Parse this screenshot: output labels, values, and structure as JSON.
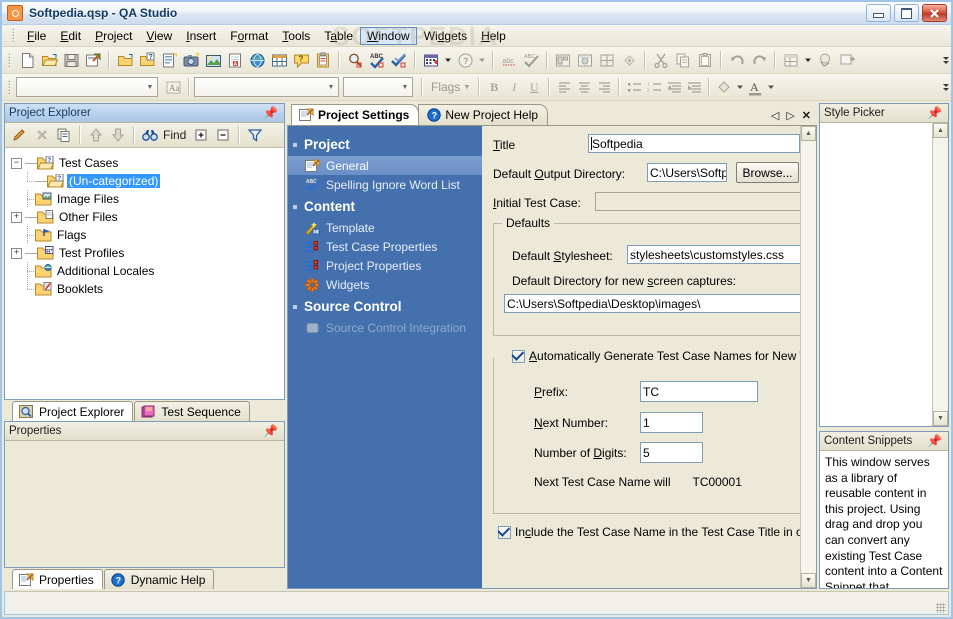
{
  "window": {
    "title": "Softpedia.qsp - QA Studio",
    "app_icon": "checkbox-orange-icon",
    "minimize": "–",
    "maximize": "□",
    "close": "✕"
  },
  "menubar": {
    "watermark": "SOFTPEDIA",
    "items": [
      {
        "label": "File",
        "accel": "F",
        "active": false
      },
      {
        "label": "Edit",
        "accel": "E",
        "active": false
      },
      {
        "label": "Project",
        "accel": "P",
        "active": false
      },
      {
        "label": "View",
        "accel": "V",
        "active": false
      },
      {
        "label": "Insert",
        "accel": "I",
        "active": false
      },
      {
        "label": "Format",
        "accel": "o",
        "active": false
      },
      {
        "label": "Tools",
        "accel": "T",
        "active": false
      },
      {
        "label": "Table",
        "accel": "a",
        "active": false
      },
      {
        "label": "Window",
        "accel": "W",
        "active": true
      },
      {
        "label": "Widgets",
        "accel": "d",
        "active": false
      },
      {
        "label": "Help",
        "accel": "H",
        "active": false
      }
    ]
  },
  "toolbar_main": {
    "buttons": [
      "new-document-icon",
      "open-folder-icon",
      "save-icon",
      "save-as-icon",
      "new-folder-icon",
      "new-test-case-icon",
      "new-page-icon",
      "screen-capture-icon",
      "insert-image-icon",
      "export-pdf-icon",
      "publish-web-icon",
      "insert-table-icon",
      "help-balloon-icon",
      "clipboard-icon",
      "find-icon",
      "spell-check-icon",
      "spell-check-all-icon",
      "calendar-add-icon",
      "help-circle-icon",
      "abc-icon",
      "spelling-icon",
      "widget-panel-icon",
      "widget-ball-icon",
      "grid-icon",
      "preview-icon",
      "cut-icon",
      "copy-icon",
      "paste-icon",
      "undo-icon",
      "redo-icon",
      "table-dropdown-icon",
      "globe-link-icon",
      "send-icon"
    ],
    "overflow": "more-buttons-icon"
  },
  "toolbar_format": {
    "style_combo_value": "",
    "font_combo_value": "",
    "size_combo_value": "",
    "change_case_icon": "change-case-icon",
    "flags_label": "Flags",
    "buttons": [
      "bold-icon",
      "italic-icon",
      "underline-icon",
      "align-left-icon",
      "align-center-icon",
      "align-right-icon",
      "bullet-list-icon",
      "numbered-list-icon",
      "decrease-indent-icon",
      "increase-indent-icon",
      "fill-color-icon",
      "font-color-icon"
    ],
    "overflow": "more-buttons-icon"
  },
  "project_explorer": {
    "title": "Project Explorer",
    "pin_icon": "pin-icon",
    "toolbar": {
      "edit": "edit-pencil-icon",
      "delete": "delete-x-icon",
      "copy": "copy-icon",
      "move_up": "arrow-up-icon",
      "move_down": "arrow-down-icon",
      "find_icon": "binoculars-icon",
      "find_label": "Find",
      "expand_all": "expand-all-icon",
      "collapse_all": "collapse-all-icon",
      "filter": "filter-funnel-icon"
    },
    "tree": [
      {
        "label": "Test Cases",
        "icon": "folder-test-cases-icon",
        "expander": "-",
        "depth": 0,
        "selected": false
      },
      {
        "label": "(Un-categorized)",
        "icon": "folder-test-cases-icon",
        "expander": "",
        "depth": 1,
        "selected": true
      },
      {
        "label": "Image Files",
        "icon": "folder-images-icon",
        "expander": "",
        "depth": 0,
        "selected": false
      },
      {
        "label": "Other Files",
        "icon": "folder-files-icon",
        "expander": "+",
        "depth": 0,
        "selected": false
      },
      {
        "label": "Flags",
        "icon": "folder-flags-icon",
        "expander": "",
        "depth": 0,
        "selected": false
      },
      {
        "label": "Test Profiles",
        "icon": "folder-profiles-icon",
        "expander": "+",
        "depth": 0,
        "selected": false
      },
      {
        "label": "Additional Locales",
        "icon": "folder-locales-icon",
        "expander": "",
        "depth": 0,
        "selected": false
      },
      {
        "label": "Booklets",
        "icon": "folder-booklets-icon",
        "expander": "",
        "depth": 0,
        "selected": false
      }
    ],
    "tabs": [
      {
        "label": "Project Explorer",
        "icon": "magnifier-icon",
        "selected": true
      },
      {
        "label": "Test Sequence",
        "icon": "book-icon",
        "selected": false
      }
    ]
  },
  "properties_panel": {
    "title": "Properties",
    "pin_icon": "pin-icon",
    "tabs": [
      {
        "label": "Properties",
        "icon": "properties-icon",
        "selected": true
      },
      {
        "label": "Dynamic Help",
        "icon": "help-circle-icon",
        "selected": false
      }
    ]
  },
  "document_tabs": {
    "tabs": [
      {
        "label": "Project Settings",
        "icon": "settings-icon",
        "selected": true
      },
      {
        "label": "New Project Help",
        "icon": "help-circle-icon",
        "selected": false
      }
    ],
    "nav_prev": "◁",
    "nav_next": "▷",
    "close": "✕"
  },
  "settings_nav": {
    "groups": [
      {
        "label": "Project",
        "items": [
          {
            "label": "General",
            "icon": "settings-icon",
            "selected": true,
            "disabled": false
          },
          {
            "label": "Spelling Ignore Word List",
            "icon": "spell-check-icon",
            "selected": false,
            "disabled": false
          }
        ]
      },
      {
        "label": "Content",
        "items": [
          {
            "label": "Template",
            "icon": "template-wand-icon",
            "selected": false,
            "disabled": false
          },
          {
            "label": "Test Case Properties",
            "icon": "list-properties-icon",
            "selected": false,
            "disabled": false
          },
          {
            "label": "Project Properties",
            "icon": "list-properties-icon",
            "selected": false,
            "disabled": false
          },
          {
            "label": "Widgets",
            "icon": "gear-icon",
            "selected": false,
            "disabled": false
          }
        ]
      },
      {
        "label": "Source Control",
        "items": [
          {
            "label": "Source Control Integration",
            "icon": "source-control-icon",
            "selected": false,
            "disabled": true
          }
        ]
      }
    ]
  },
  "settings_form": {
    "title_label": "Title",
    "title_accel": "T",
    "title_value": "Softpedia",
    "output_dir_label": "Default Output Directory:",
    "output_dir_accel": "O",
    "output_dir_value": "C:\\Users\\Softpı",
    "browse_label": "Browse...",
    "initial_test_case_label": "Initial Test Case:",
    "initial_test_case_accel": "I",
    "initial_test_case_value": "",
    "defaults_group": {
      "legend": "Defaults",
      "stylesheet_label": "Default Stylesheet:",
      "stylesheet_accel": "S",
      "stylesheet_value": "stylesheets\\customstyles.css",
      "capture_dir_label": "Default Directory for new screen captures:",
      "capture_dir_accel": "s",
      "capture_dir_value": "C:\\Users\\Softpedia\\Desktop\\images\\"
    },
    "autogen_group": {
      "checkbox_label": "Automatically Generate Test Case Names for New Test C",
      "checkbox_accel": "A",
      "checked": true,
      "prefix_label": "Prefix:",
      "prefix_accel": "P",
      "prefix_value": "TC",
      "next_number_label": "Next Number:",
      "next_number_accel": "N",
      "next_number_value": "1",
      "digits_label": "Number of Digits:",
      "digits_accel": "D",
      "digits_value": "5",
      "preview_label": "Next Test Case Name will",
      "preview_value": "TC00001"
    },
    "include_name_checkbox": {
      "label": "Include the Test Case Name in the Test Case Title in outpu",
      "accel": "c",
      "checked": true
    }
  },
  "style_picker": {
    "title": "Style Picker",
    "pin_icon": "pin-icon",
    "scroll_up": "▲",
    "scroll_down": "▼"
  },
  "content_snippets": {
    "title": "Content Snippets",
    "pin_icon": "pin-icon",
    "body_text": "This window serves as a library of reusable content in this project. Using drag and drop you can convert any existing Test Case content into a Content Snippet that"
  },
  "status_bar": {
    "text": "",
    "resize_grip": "resize-grip-icon"
  }
}
